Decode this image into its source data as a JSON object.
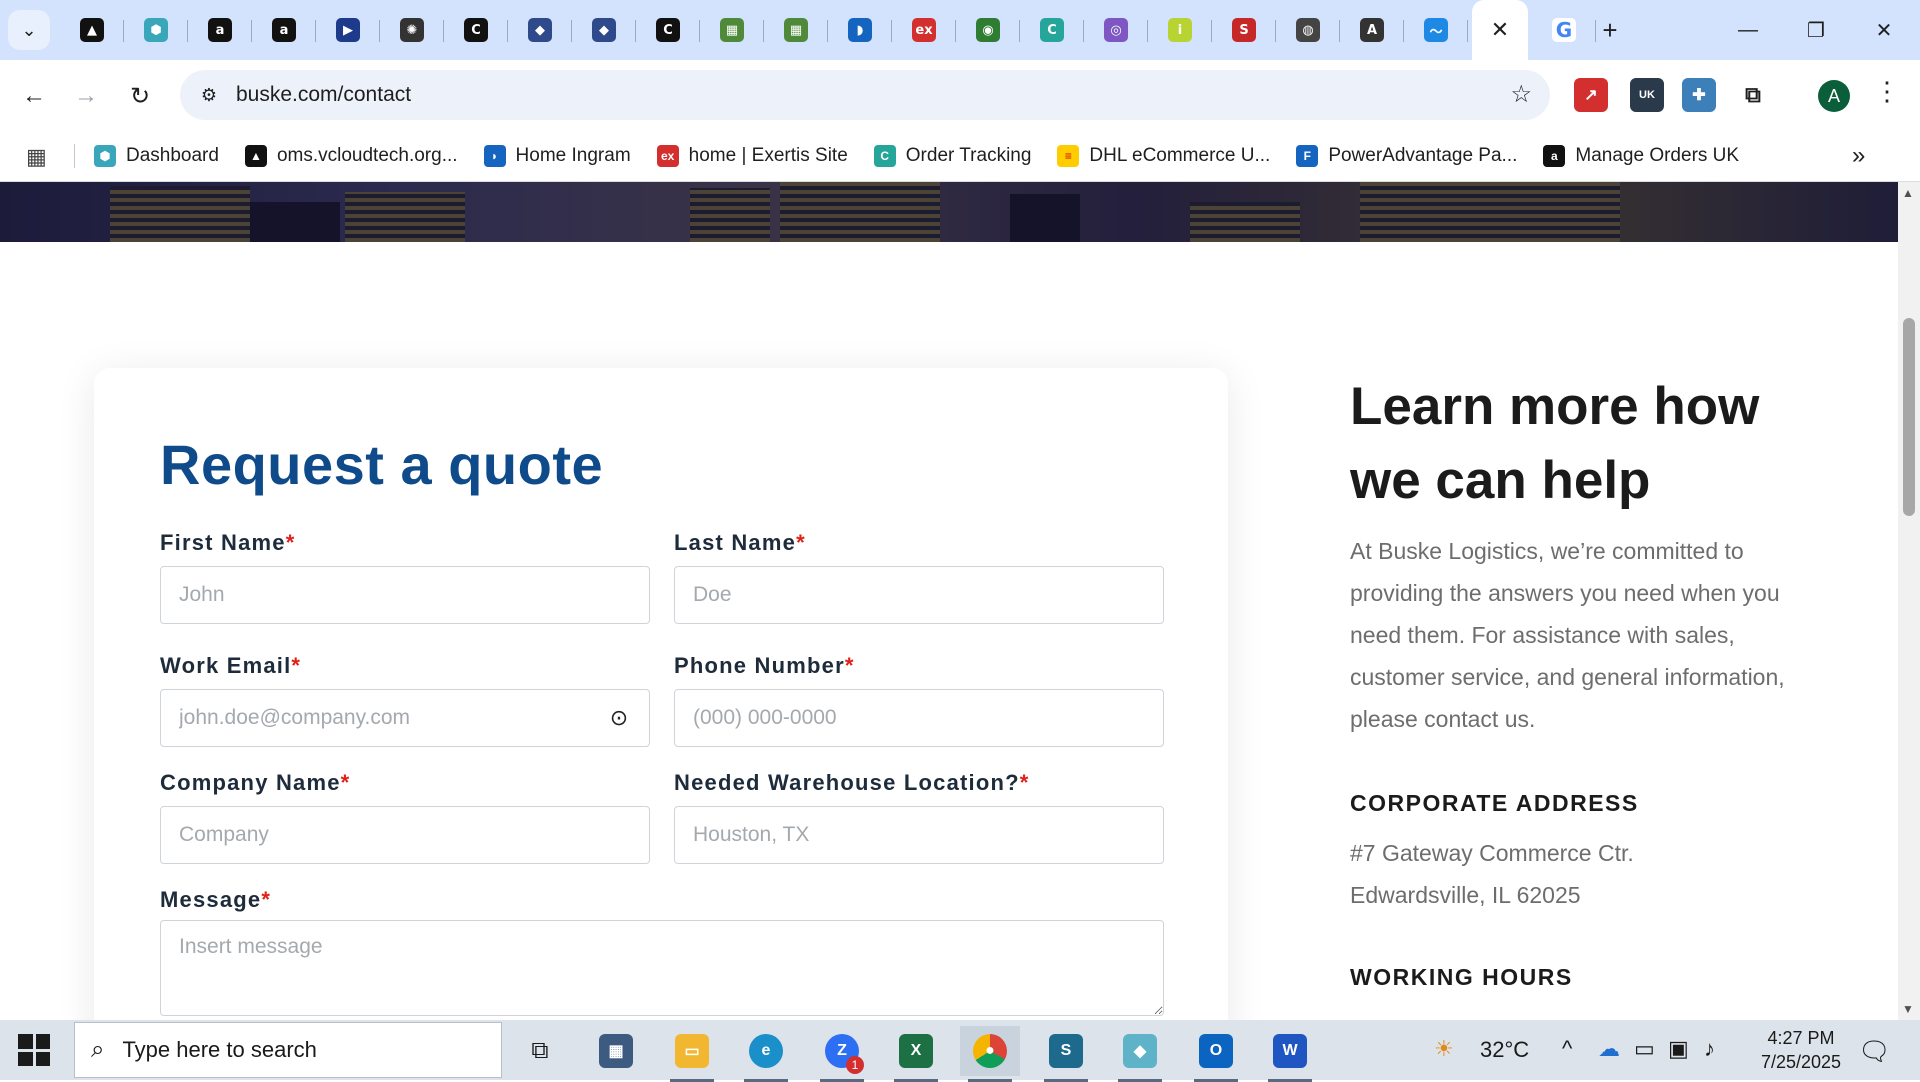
{
  "browser": {
    "tabs": [
      {
        "icon": "oms-triangle-icon",
        "color": "#111111",
        "glyph": "▲"
      },
      {
        "icon": "hexagon-dashboard-icon",
        "color": "#3aa6b9",
        "glyph": "⬢"
      },
      {
        "icon": "amazon-icon",
        "color": "#111111",
        "glyph": "a"
      },
      {
        "icon": "amazon-icon",
        "color": "#111111",
        "glyph": "a"
      },
      {
        "icon": "play-arrow-icon",
        "color": "#1e3a8a",
        "glyph": "▶"
      },
      {
        "icon": "chatgpt-icon",
        "color": "#333333",
        "glyph": "✺"
      },
      {
        "icon": "c-logo-icon",
        "color": "#111111",
        "glyph": "C"
      },
      {
        "icon": "box-icon",
        "color": "#2f4a8a",
        "glyph": "◆"
      },
      {
        "icon": "box-icon",
        "color": "#2f4a8a",
        "glyph": "◆"
      },
      {
        "icon": "c-logo-icon",
        "color": "#111111",
        "glyph": "C"
      },
      {
        "icon": "warehouse-icon",
        "color": "#4f8a3a",
        "glyph": "▦"
      },
      {
        "icon": "warehouse-icon",
        "color": "#4f8a3a",
        "glyph": "▦"
      },
      {
        "icon": "ingram-icon",
        "color": "#1565c0",
        "glyph": "◗"
      },
      {
        "icon": "exertis-icon",
        "color": "#d32f2f",
        "glyph": "ex"
      },
      {
        "icon": "leaf-icon",
        "color": "#2e7d32",
        "glyph": "◉"
      },
      {
        "icon": "order-tracking-icon",
        "color": "#26a69a",
        "glyph": "C"
      },
      {
        "icon": "fingerprint-icon",
        "color": "#7e57c2",
        "glyph": "◎"
      },
      {
        "icon": "infos-icon",
        "color": "#b8d432",
        "glyph": "i"
      },
      {
        "icon": "shwe-icon",
        "color": "#c62828",
        "glyph": "S"
      },
      {
        "icon": "chromium-icon",
        "color": "#444444",
        "glyph": "◍"
      },
      {
        "icon": "ams-icon",
        "color": "#333333",
        "glyph": "A"
      },
      {
        "icon": "bird-icon",
        "color": "#1e88e5",
        "glyph": "〜"
      }
    ],
    "active_tab_icon": "close-icon",
    "google_tab": {
      "icon": "google-icon",
      "glyph": "G",
      "color": "#4285f4"
    },
    "url": "buske.com/contact",
    "bookmarks": [
      {
        "label": "Dashboard",
        "icon": "hexagon-dashboard-icon",
        "color": "#3aa6b9",
        "glyph": "⬢"
      },
      {
        "label": "oms.vcloudtech.org...",
        "icon": "oms-triangle-icon",
        "color": "#111111",
        "glyph": "▲"
      },
      {
        "label": "Home Ingram",
        "icon": "ingram-icon",
        "color": "#1565c0",
        "glyph": "◗"
      },
      {
        "label": "home | Exertis Site",
        "icon": "exertis-icon",
        "color": "#d32f2f",
        "glyph": "ex"
      },
      {
        "label": "Order Tracking",
        "icon": "order-tracking-icon",
        "color": "#26a69a",
        "glyph": "C"
      },
      {
        "label": "DHL eCommerce U...",
        "icon": "dhl-icon",
        "color": "#ffcc00",
        "glyph": "≡"
      },
      {
        "label": "PowerAdvantage Pa...",
        "icon": "poweradvantage-icon",
        "color": "#1565c0",
        "glyph": "F"
      },
      {
        "label": "Manage Orders UK",
        "icon": "amazon-icon",
        "color": "#111111",
        "glyph": "a"
      }
    ],
    "profile_initial": "A",
    "extension_badge": "UK"
  },
  "page": {
    "form": {
      "title": "Request a quote",
      "required_mark": "*",
      "first_name": {
        "label": "First Name",
        "placeholder": "John"
      },
      "last_name": {
        "label": "Last Name",
        "placeholder": "Doe"
      },
      "work_email": {
        "label": "Work Email",
        "placeholder": "john.doe@company.com"
      },
      "phone": {
        "label": "Phone Number",
        "placeholder": "(000) 000-0000"
      },
      "company": {
        "label": "Company Name",
        "placeholder": "Company"
      },
      "warehouse": {
        "label": "Needed Warehouse Location?",
        "placeholder": "Houston, TX"
      },
      "message": {
        "label": "Message",
        "placeholder": "Insert message"
      }
    },
    "sidebar": {
      "title": "Learn more how we can help",
      "intro": "At Buske Logistics, we’re committed to providing the answers you need when you need them. For assistance with sales, customer service, and general information, please contact us.",
      "address_heading": "CORPORATE ADDRESS",
      "address_line1": "#7 Gateway Commerce Ctr.",
      "address_line2": "Edwardsville, IL 62025",
      "hours_heading": "WORKING HOURS"
    }
  },
  "taskbar": {
    "search_placeholder": "Type here to search",
    "weather": "32°C",
    "time": "4:27 PM",
    "date": "7/25/2025",
    "zoom_badge": "1"
  }
}
